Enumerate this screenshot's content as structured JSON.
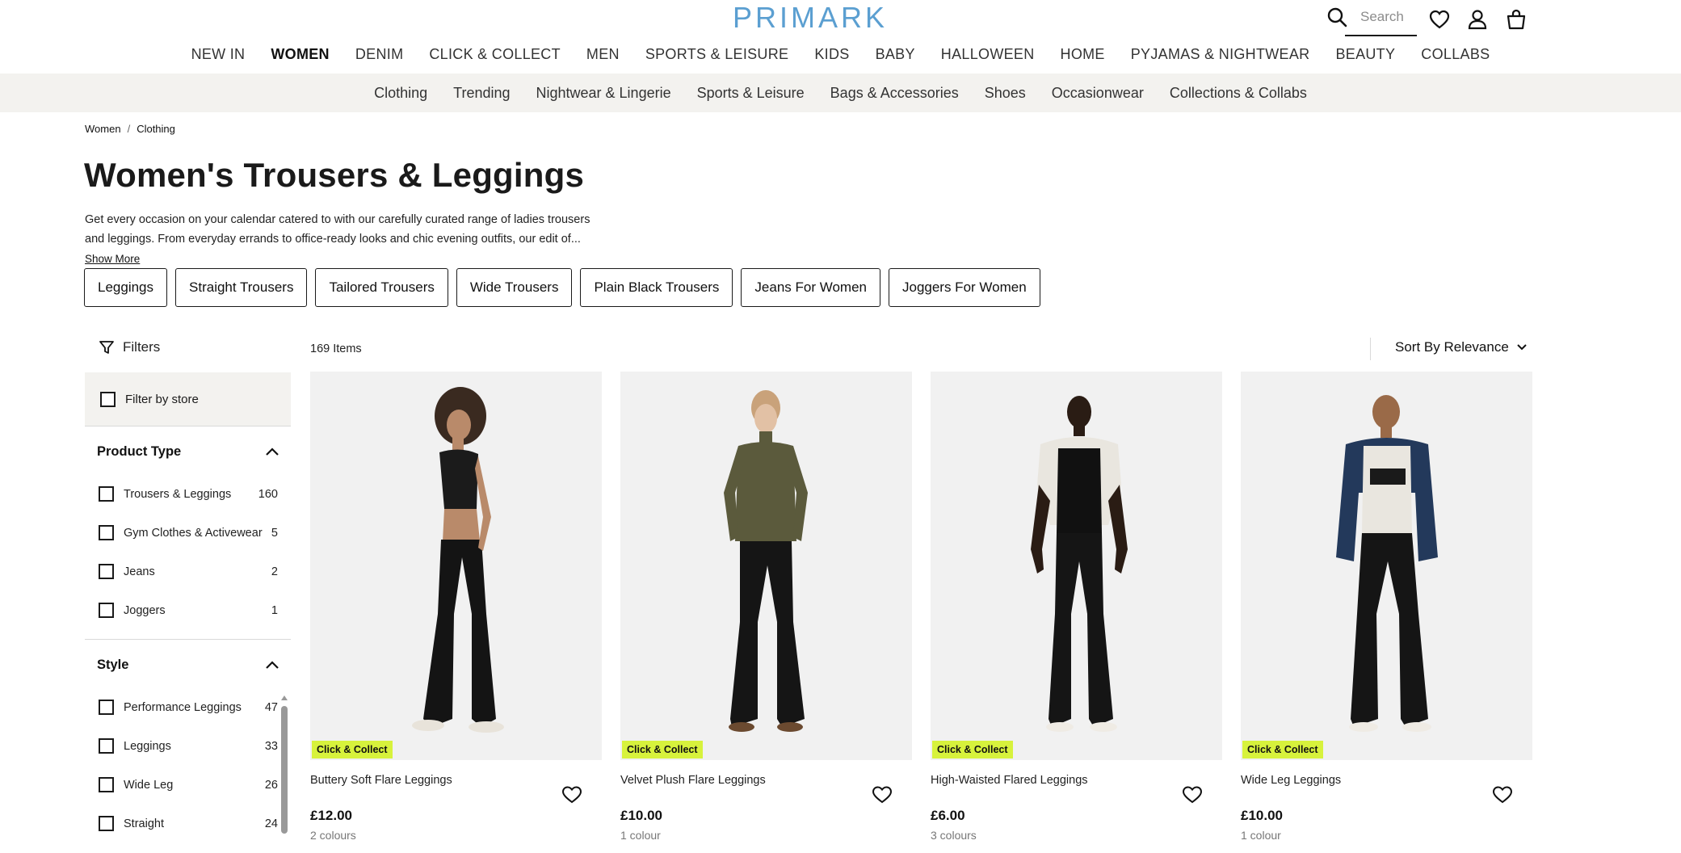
{
  "header": {
    "logo": "PRIMARK",
    "search_placeholder": "Search"
  },
  "main_nav": [
    "NEW IN",
    "WOMEN",
    "DENIM",
    "CLICK & COLLECT",
    "MEN",
    "SPORTS & LEISURE",
    "KIDS",
    "BABY",
    "HALLOWEEN",
    "HOME",
    "PYJAMAS & NIGHTWEAR",
    "BEAUTY",
    "COLLABS"
  ],
  "main_nav_active": "WOMEN",
  "sub_nav": [
    "Clothing",
    "Trending",
    "Nightwear & Lingerie",
    "Sports & Leisure",
    "Bags & Accessories",
    "Shoes",
    "Occasionwear",
    "Collections & Collabs"
  ],
  "breadcrumb": [
    "Women",
    "/",
    "Clothing"
  ],
  "page": {
    "title": "Women's Trousers & Leggings",
    "description_line1": "Get every occasion on your calendar catered to with our carefully curated range of ladies trousers",
    "description_line2": "and leggings. From everyday errands to office-ready looks and chic evening outfits, our edit of...",
    "show_more": "Show More"
  },
  "chips": [
    "Leggings",
    "Straight Trousers",
    "Tailored Trousers",
    "Wide Trousers",
    "Plain Black Trousers",
    "Jeans For Women",
    "Joggers For Women"
  ],
  "filters": {
    "label": "Filters",
    "store_label": "Filter by store",
    "product_type": {
      "title": "Product Type",
      "items": [
        {
          "label": "Trousers & Leggings",
          "count": "160"
        },
        {
          "label": "Gym Clothes & Activewear",
          "count": "5"
        },
        {
          "label": "Jeans",
          "count": "2"
        },
        {
          "label": "Joggers",
          "count": "1"
        }
      ]
    },
    "style": {
      "title": "Style",
      "items": [
        {
          "label": "Performance Leggings",
          "count": "47"
        },
        {
          "label": "Leggings",
          "count": "33"
        },
        {
          "label": "Wide Leg",
          "count": "26"
        },
        {
          "label": "Straight",
          "count": "24"
        }
      ]
    }
  },
  "results": {
    "count": "169 Items",
    "sort_label": "Sort By Relevance"
  },
  "products": [
    {
      "badge": "Click & Collect",
      "name": "Buttery Soft Flare Leggings",
      "price": "£12.00",
      "colours": "2 colours"
    },
    {
      "badge": "Click & Collect",
      "name": "Velvet Plush Flare Leggings",
      "price": "£10.00",
      "colours": "1 colour"
    },
    {
      "badge": "Click & Collect",
      "name": "High-Waisted Flared Leggings",
      "price": "£6.00",
      "colours": "3 colours"
    },
    {
      "badge": "Click & Collect",
      "name": "Wide Leg Leggings",
      "price": "£10.00",
      "colours": "1 colour"
    }
  ],
  "colors": {
    "logo": "#5b9fd1",
    "badge": "#d7f23c",
    "subnav_bg": "#f3f2ef"
  }
}
